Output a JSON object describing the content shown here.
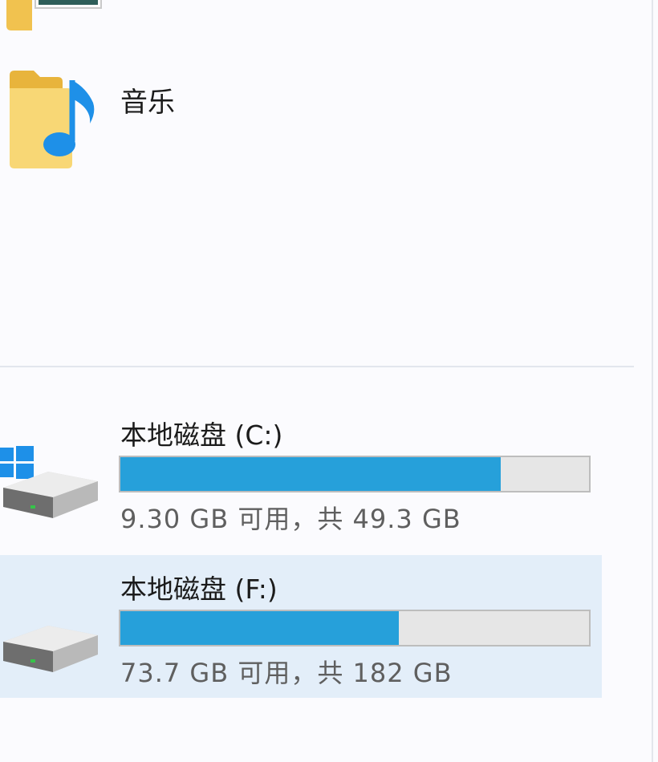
{
  "folders": [
    {
      "label": "",
      "icon": "pictures-folder-icon"
    },
    {
      "label": "音乐",
      "icon": "music-folder-icon"
    }
  ],
  "drives": [
    {
      "name": "本地磁盘 (C:)",
      "info": "9.30 GB 可用，共 49.3 GB",
      "used_fraction": 0.811,
      "icon": "system-drive-icon",
      "selected": false
    },
    {
      "name": "本地磁盘 (F:)",
      "info": "73.7 GB 可用，共 182 GB",
      "used_fraction": 0.595,
      "icon": "hard-drive-icon",
      "selected": true
    }
  ],
  "colors": {
    "bar_fill": "#26a0da",
    "bar_track": "#e6e6e6",
    "selection": "#e3eef9",
    "folder_yellow": "#f8d775",
    "music_blue": "#1e90e8"
  }
}
